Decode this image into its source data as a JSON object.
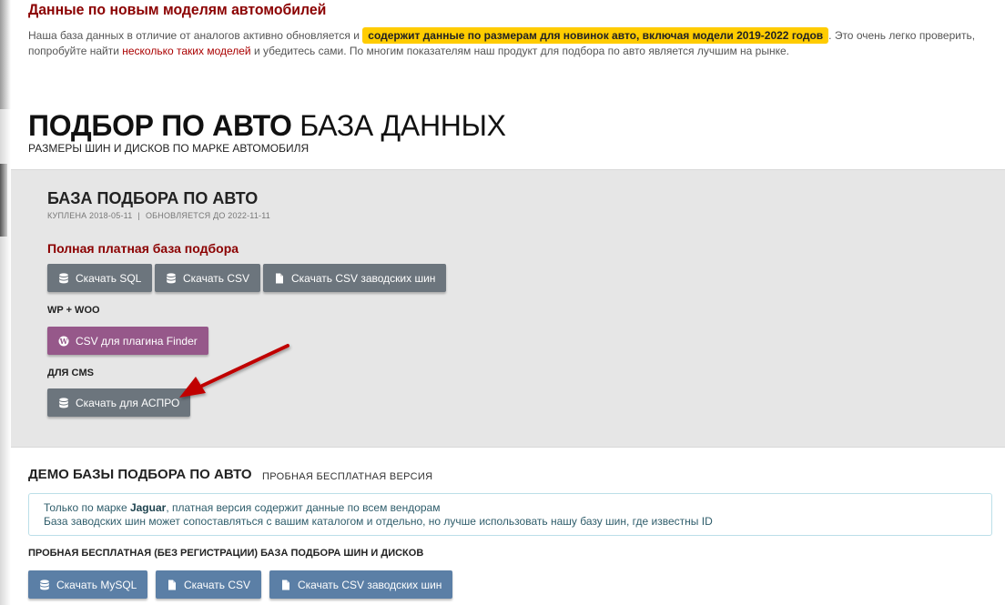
{
  "intro": {
    "title": "Данные по новым моделям автомобилей",
    "text_before": "Наша база данных в отличие от аналогов активно обновляется и ",
    "highlight": "содержит данные по размерам для новинок авто, включая модели 2019-2022 годов",
    "text_middle": ". Это очень легко проверить, попробуйте найти ",
    "link": "несколько таких моделей",
    "text_after": " и убедитесь сами. По многим показателям наш продукт для подбора по авто является лучшим на рынке."
  },
  "hero": {
    "title_bold": "ПОДБОР ПО АВТО",
    "title_light": " БАЗА ДАННЫХ",
    "subtitle": "РАЗМЕРЫ ШИН И ДИСКОВ ПО МАРКЕ АВТОМОБИЛЯ"
  },
  "panel": {
    "title": "БАЗА ПОДБОРА ПО АВТО",
    "meta_bought": "КУПЛЕНА 2018-05-11",
    "meta_separator": "|",
    "meta_updated": "ОБНОВЛЯЕТСЯ ДО 2022-11-11",
    "paid_label": "Полная платная база подбора",
    "paid_buttons": [
      {
        "label": "Скачать SQL",
        "icon": "database-icon"
      },
      {
        "label": "Скачать CSV",
        "icon": "database-icon"
      },
      {
        "label": "Скачать CSV заводских шин",
        "icon": "file-icon"
      }
    ],
    "wp_label": "WP + WOO",
    "wp_button": {
      "label": "CSV для плагина Finder",
      "icon": "wordpress-icon"
    },
    "cms_label": "ДЛЯ CMS",
    "cms_button": {
      "label": "Скачать для АСПРО",
      "icon": "database-icon"
    }
  },
  "demo": {
    "title": "ДЕМО БАЗЫ ПОДБОРА ПО АВТО",
    "subtitle": "ПРОБНАЯ БЕСПЛАТНАЯ ВЕРСИЯ",
    "info_line1_before": "Только по марке ",
    "info_line1_brand": "Jaguar",
    "info_line1_after": ", платная версия содержит данные по всем вендорам",
    "info_line2": "База заводских шин может сопоставляться с вашим каталогом и отдельно, но лучше использовать нашу базу шин, где известны ID",
    "label": "ПРОБНАЯ БЕСПЛАТНАЯ (БЕЗ РЕГИСТРАЦИИ) БАЗА ПОДБОРА ШИН И ДИСКОВ",
    "buttons": [
      {
        "label": "Скачать MySQL",
        "icon": "database-icon"
      },
      {
        "label": "Скачать CSV",
        "icon": "file-icon"
      },
      {
        "label": "Скачать CSV заводских шин",
        "icon": "file-icon"
      }
    ]
  },
  "colors": {
    "accent_red": "#8b0000",
    "highlight_yellow": "#ffcc00",
    "button_gray": "#6c757d",
    "button_purple": "#96588a",
    "button_blue": "#5b7fa6",
    "arrow_red": "#c00000"
  }
}
